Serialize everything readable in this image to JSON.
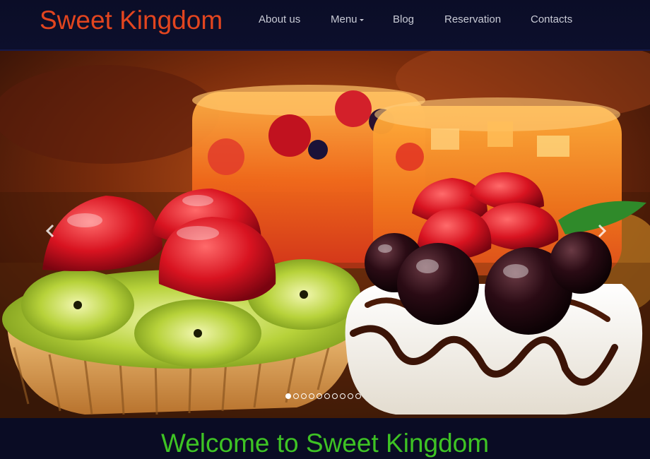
{
  "header": {
    "logo": "Sweet Kingdom",
    "nav": [
      {
        "label": "About us",
        "has_dropdown": false
      },
      {
        "label": "Menu",
        "has_dropdown": true
      },
      {
        "label": "Blog",
        "has_dropdown": false
      },
      {
        "label": "Reservation",
        "has_dropdown": false
      },
      {
        "label": "Contacts",
        "has_dropdown": false
      }
    ]
  },
  "slider": {
    "slide_count": 10,
    "active_slide": 1,
    "prev_icon": "chevron-left-icon",
    "next_icon": "chevron-right-icon"
  },
  "welcome": {
    "title": "Welcome to Sweet Kingdom"
  },
  "colors": {
    "logo": "#e2451f",
    "welcome_title": "#3ec324",
    "header_bg": "#0b0d27",
    "nav_text": "#c9cbd6"
  }
}
